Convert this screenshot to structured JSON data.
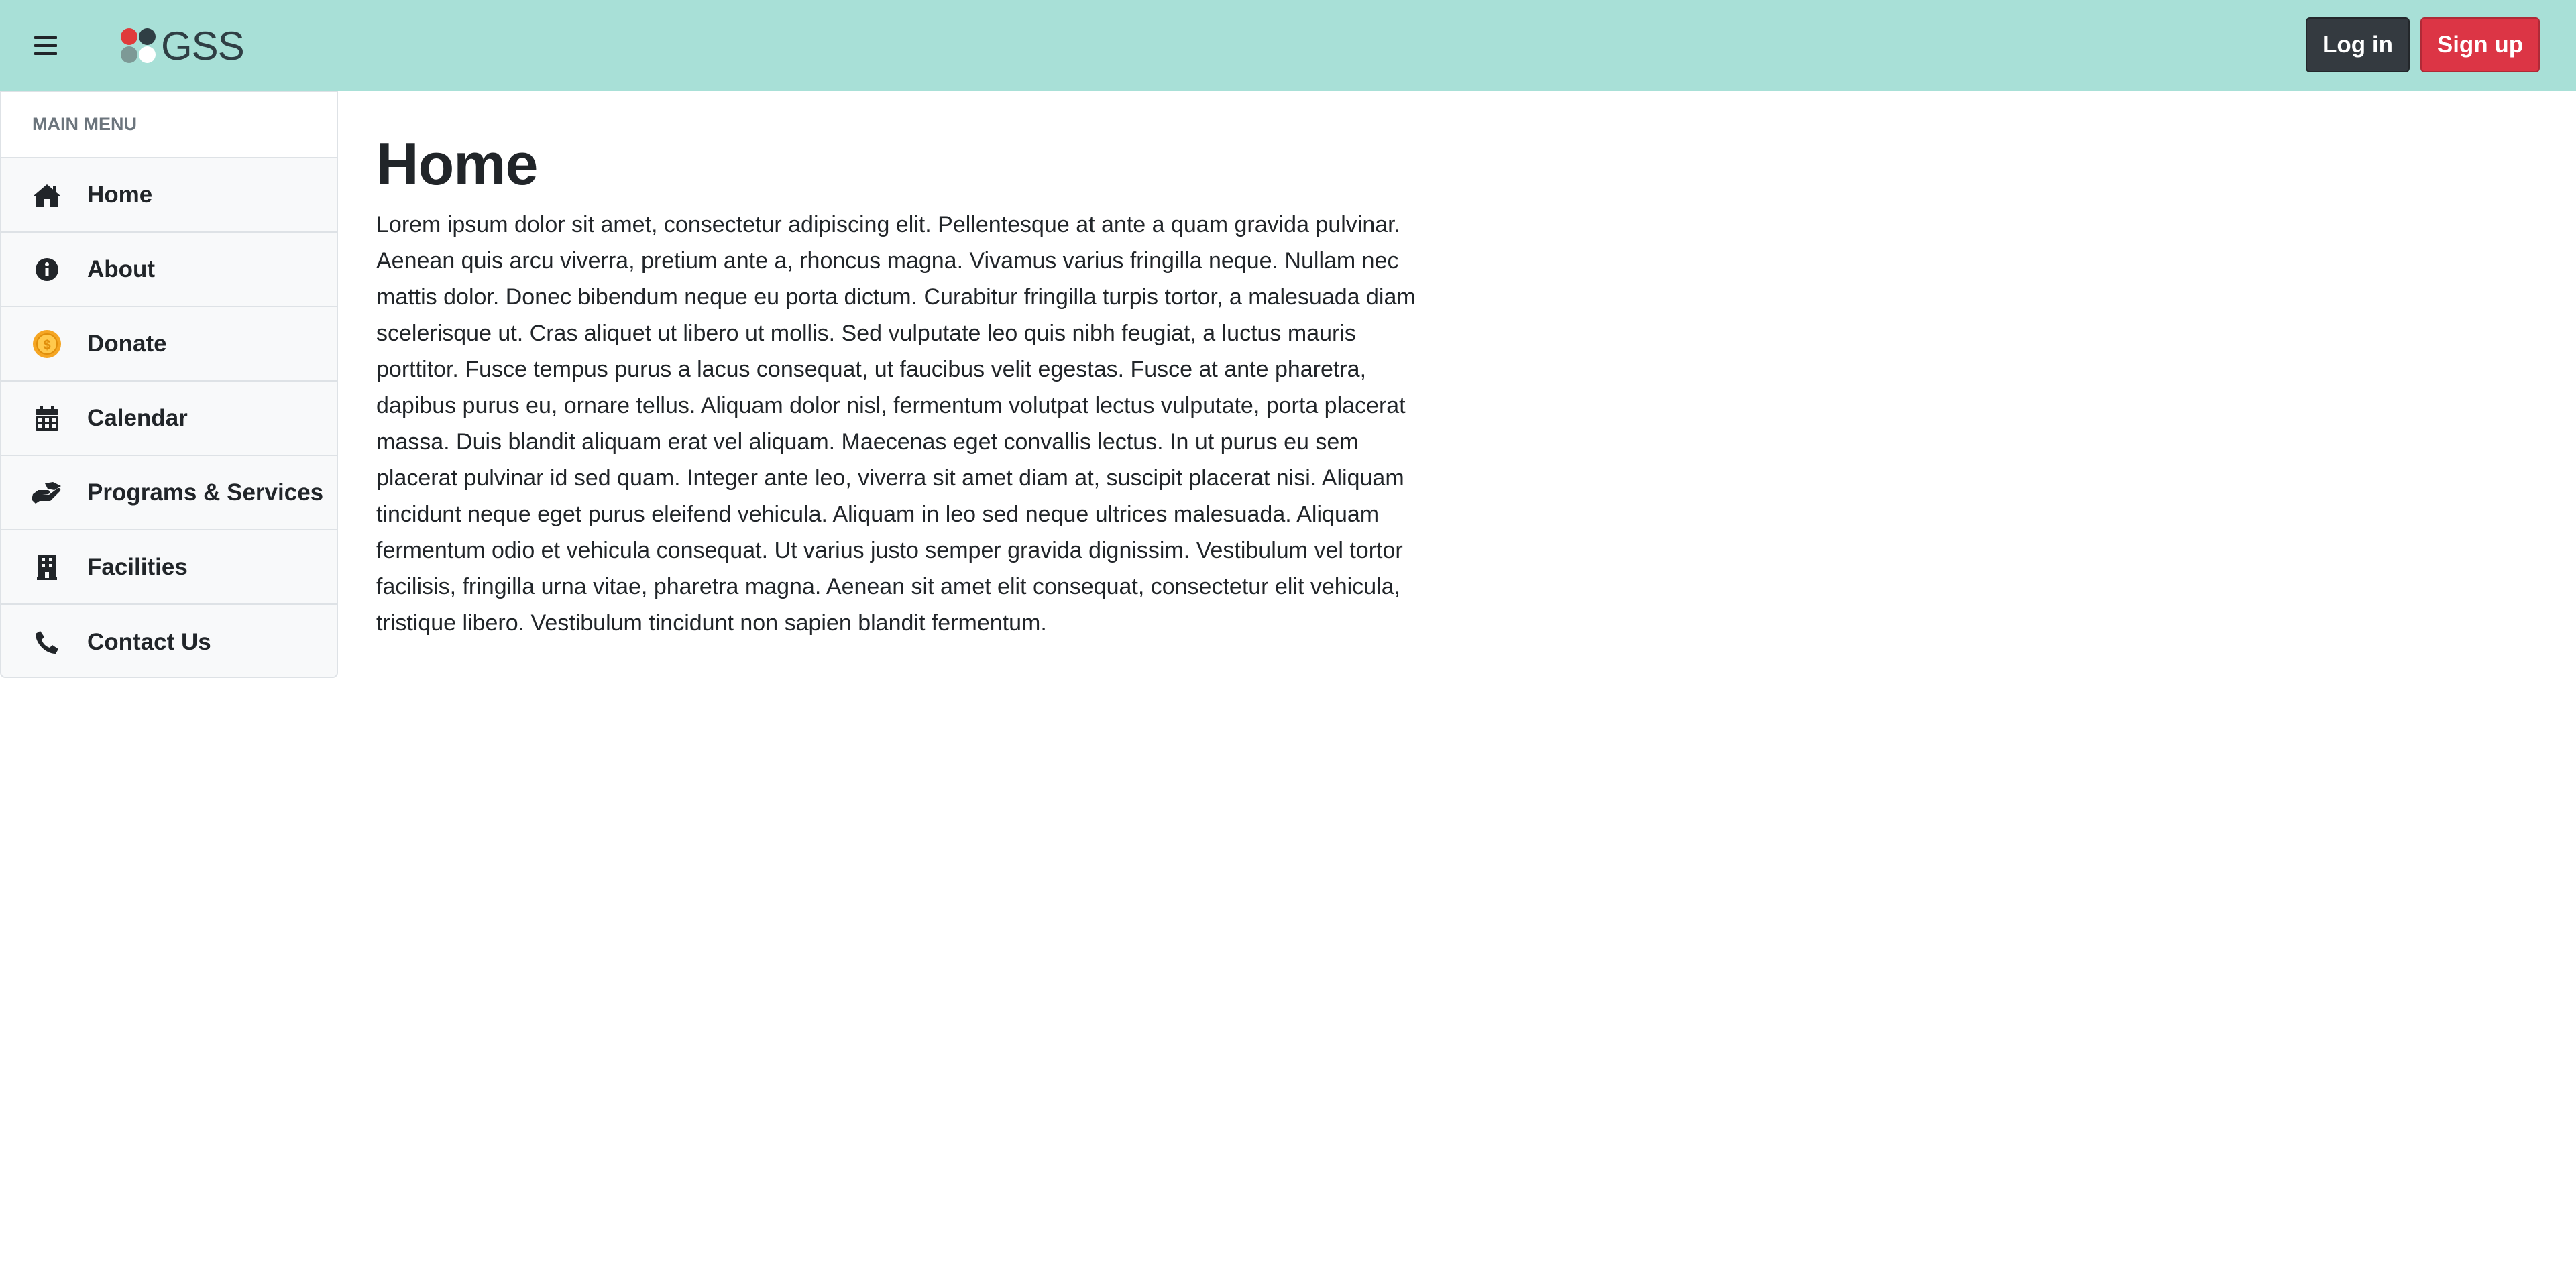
{
  "header": {
    "brand": "GSS",
    "menu_icon": "hamburger-menu-icon",
    "login_label": "Log in",
    "signup_label": "Sign up",
    "colors": {
      "bar": "#a8e0d7",
      "login": "#343a40",
      "signup": "#dc3545"
    }
  },
  "sidebar": {
    "header": "MAIN MENU",
    "items": [
      {
        "label": "Home",
        "icon": "home-icon"
      },
      {
        "label": "About",
        "icon": "info-circle-icon"
      },
      {
        "label": "Donate",
        "icon": "coin-icon"
      },
      {
        "label": "Calendar",
        "icon": "calendar-icon"
      },
      {
        "label": "Programs & Services",
        "icon": "hand-holding-icon"
      },
      {
        "label": "Facilities",
        "icon": "building-icon"
      },
      {
        "label": "Contact Us",
        "icon": "phone-icon"
      }
    ]
  },
  "main": {
    "title": "Home",
    "body": "Lorem ipsum dolor sit amet, consectetur adipiscing elit. Pellentesque at ante a quam gravida pulvinar. Aenean quis arcu viverra, pretium ante a, rhoncus magna. Vivamus varius fringilla neque. Nullam nec mattis dolor. Donec bibendum neque eu porta dictum. Curabitur fringilla turpis tortor, a malesuada diam scelerisque ut. Cras aliquet ut libero ut mollis. Sed vulputate leo quis nibh feugiat, a luctus mauris porttitor. Fusce tempus purus a lacus consequat, ut faucibus velit egestas. Fusce at ante pharetra, dapibus purus eu, ornare tellus. Aliquam dolor nisl, fermentum volutpat lectus vulputate, porta placerat massa. Duis blandit aliquam erat vel aliquam. Maecenas eget convallis lectus. In ut purus eu sem placerat pulvinar id sed quam. Integer ante leo, viverra sit amet diam at, suscipit placerat nisi. Aliquam tincidunt neque eget purus eleifend vehicula. Aliquam in leo sed neque ultrices malesuada. Aliquam fermentum odio et vehicula consequat. Ut varius justo semper gravida dignissim. Vestibulum vel tortor facilisis, fringilla urna vitae, pharetra magna. Aenean sit amet elit consequat, consectetur elit vehicula, tristique libero. Vestibulum tincidunt non sapien blandit fermentum."
  }
}
